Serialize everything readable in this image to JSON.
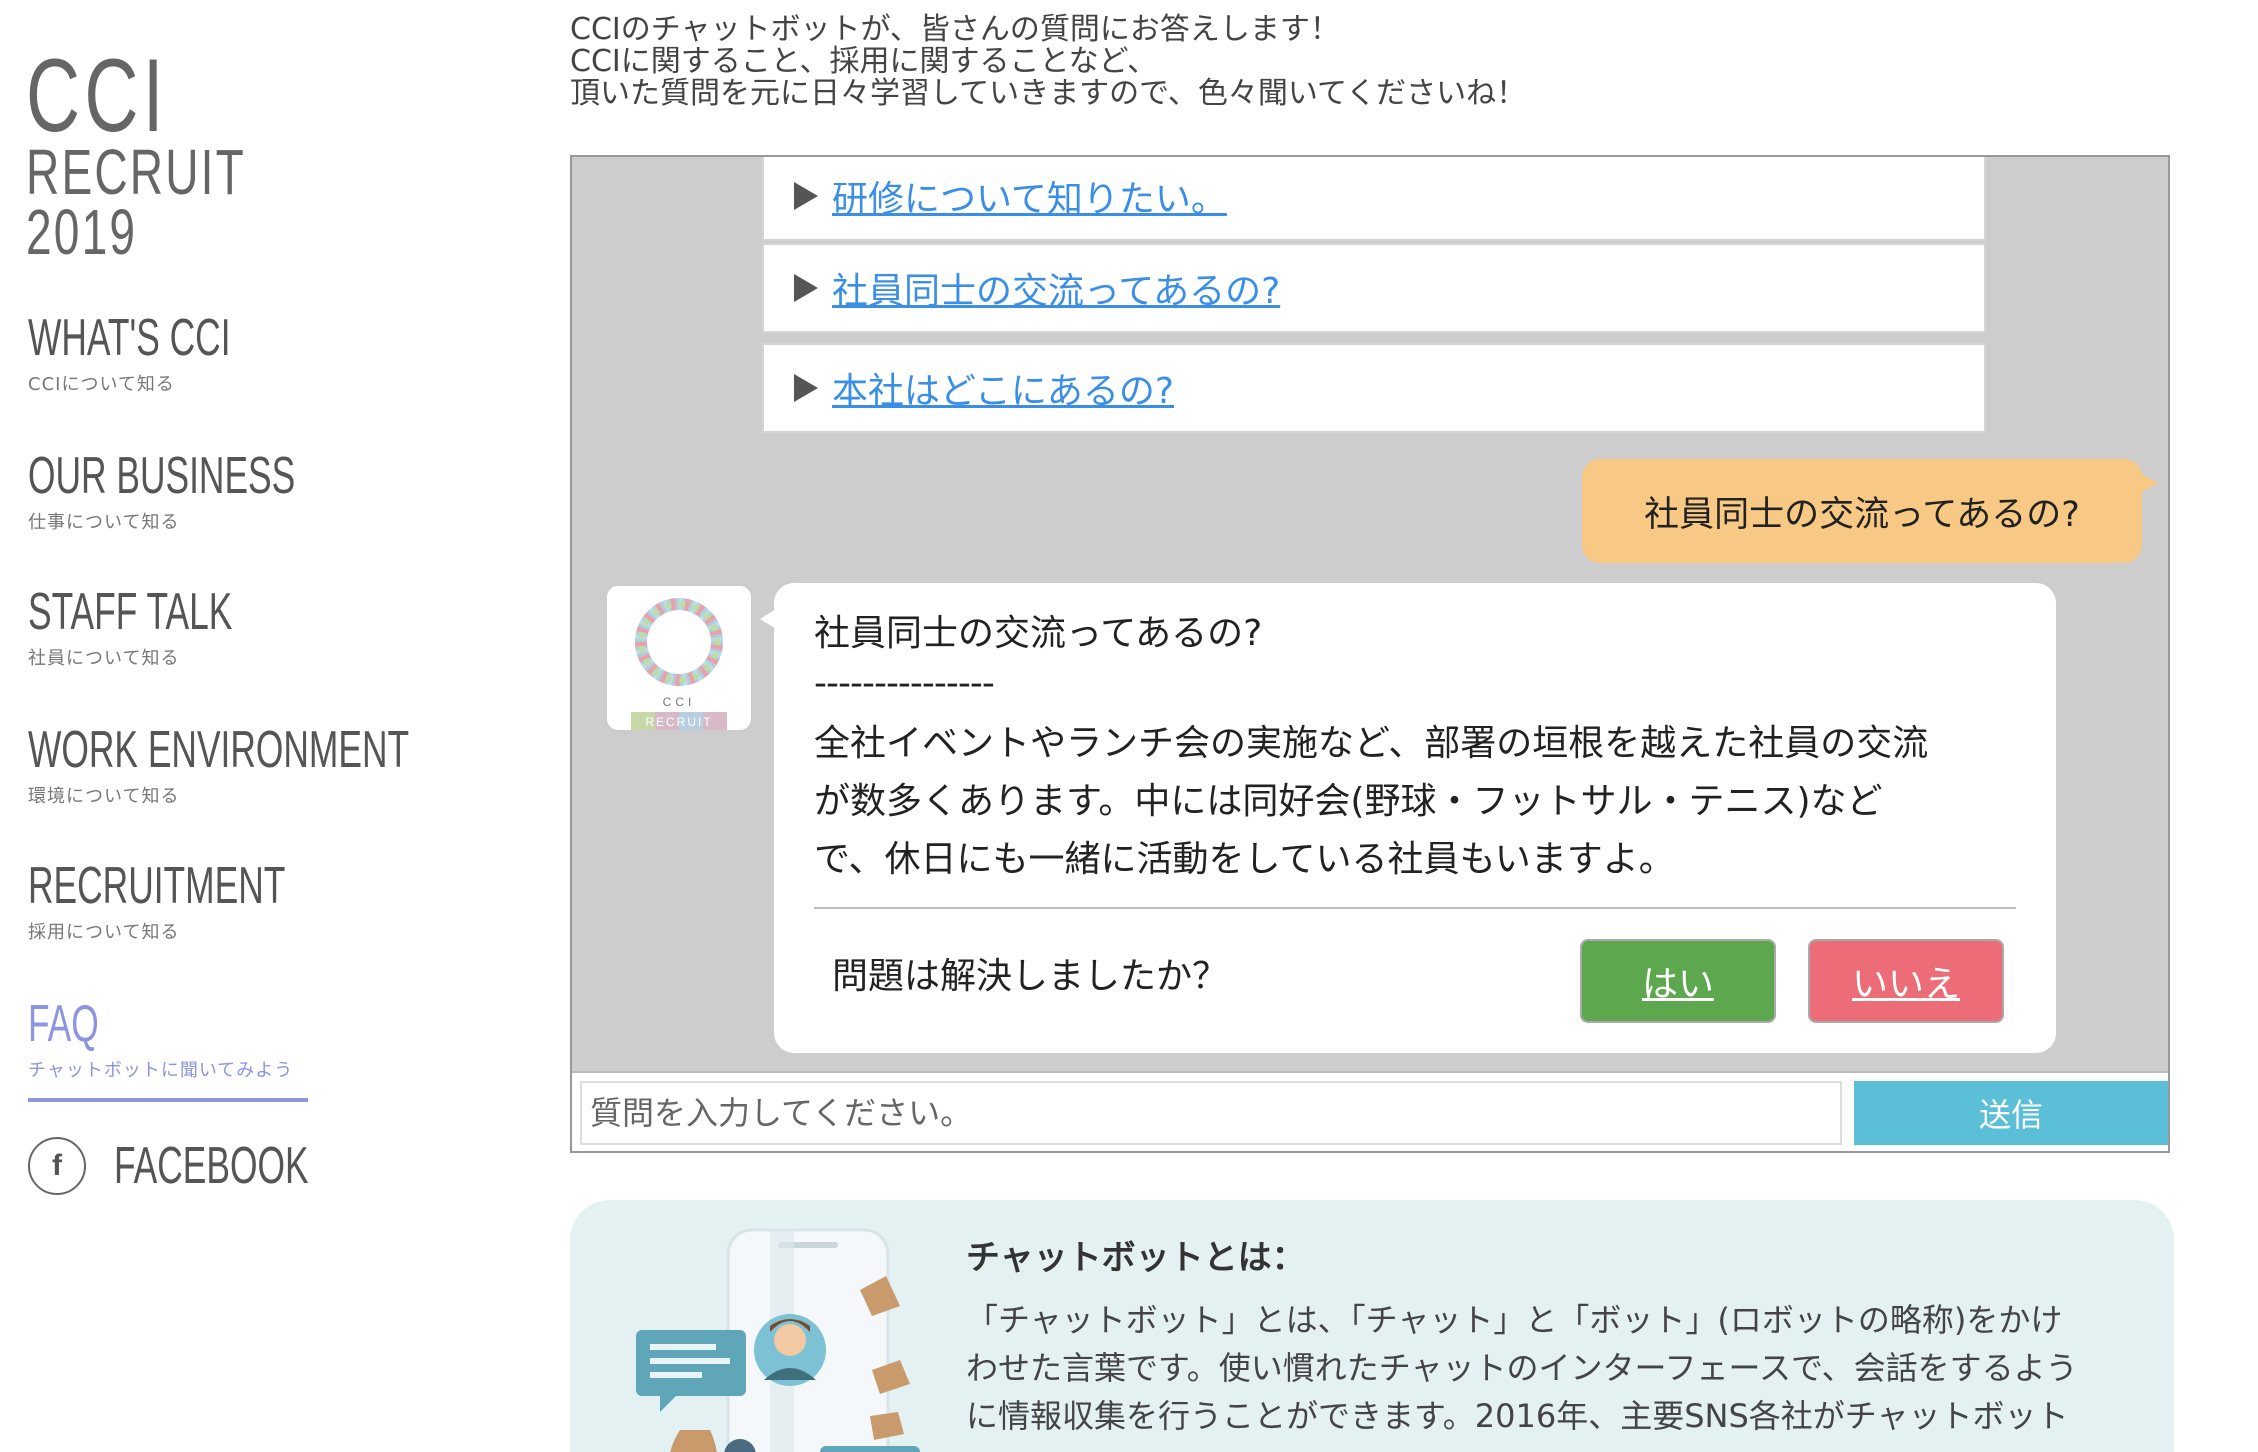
{
  "logo": {
    "line1": "CCI",
    "line2": "RECRUIT",
    "line3": "2019"
  },
  "nav": [
    {
      "title": "WHAT'S CCI",
      "sub": "CCIについて知る"
    },
    {
      "title": "OUR BUSINESS",
      "sub": "仕事について知る"
    },
    {
      "title": "STAFF TALK",
      "sub": "社員について知る"
    },
    {
      "title": "WORK ENVIRONMENT",
      "sub": "環境について知る"
    },
    {
      "title": "RECRUITMENT",
      "sub": "採用について知る"
    },
    {
      "title": "FAQ",
      "sub": "チャットボットに聞いてみよう"
    }
  ],
  "facebook": {
    "icon": "f",
    "label": "FACEBOOK"
  },
  "intro": [
    "CCIのチャットボットが、皆さんの質問にお答えします！",
    "CCIに関すること、採用に関することなど、",
    "頂いた質問を元に日々学習していきますので、色々聞いてくださいね！"
  ],
  "chat": {
    "suggestions": [
      "研修について知りたい。",
      "社員同士の交流ってあるの?",
      "本社はどこにあるの?"
    ],
    "user_message": "社員同士の交流ってあるの?",
    "avatar": {
      "brand": "CCI",
      "ribbon": "RECRUIT"
    },
    "bot": {
      "question": "社員同士の交流ってあるの?",
      "separator": "---------------",
      "answer_lines": [
        "全社イベントやランチ会の実施など、部署の垣根を越えた社員の交流",
        "が数多くあります。中には同好会(野球・フットサル・テニス)など",
        "で、休日にも一緒に活動をしている社員もいますよ。"
      ],
      "resolved_question": "問題は解決しましたか？",
      "yes_label": "はい",
      "no_label": "いいえ"
    },
    "input_placeholder": "質問を入力してください。",
    "send_label": "送信"
  },
  "info": {
    "title": "チャットボットとは：",
    "body_lines": [
      "「チャットボット」とは、「チャット」と「ボット」(ロボットの略称)をかけ",
      "わせた言葉です。使い慣れたチャットのインターフェースで、会話をするよう",
      "に情報収集を行うことができます。2016年、主要SNS各社がチャットボット"
    ]
  },
  "colors": {
    "accent_nav": "#8d95e0",
    "user_bubble": "#f7c985",
    "yes_button": "#5da84e",
    "no_button": "#ec6d78",
    "send_button": "#5bbfd7",
    "link": "#3a8ee6",
    "chat_bg": "#cdcdcd",
    "info_bg": "#e4f1f3"
  }
}
